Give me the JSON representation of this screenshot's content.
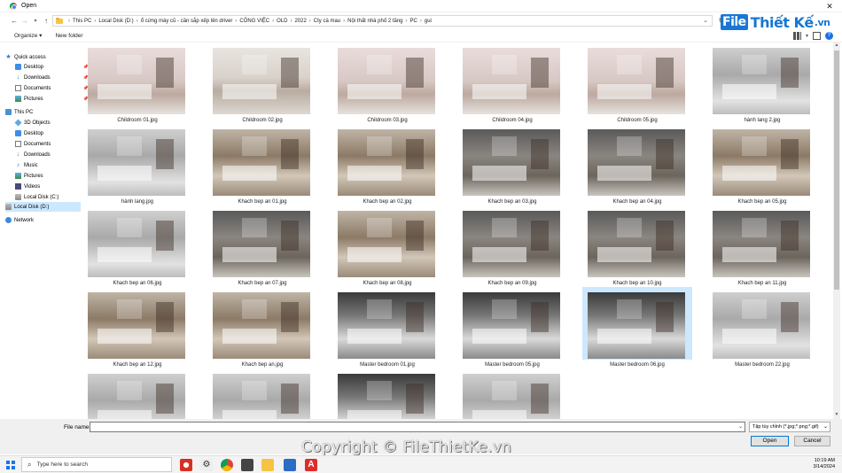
{
  "window": {
    "title": "Open"
  },
  "address": {
    "crumbs": [
      "This PC",
      "Local Disk (D:)",
      "ổ cứng máy cũ - cần sắp xếp lên driver",
      "CÔNG VIỆC",
      "OLD",
      "2022",
      "Cty cà mau",
      "Nội thất nhà phố 2 tầng",
      "PC",
      "gui"
    ]
  },
  "logo": {
    "file": "File",
    "rest": "Thiết Kế",
    "tld": ".vn"
  },
  "toolbar": {
    "organize": "Organize ▾",
    "new_folder": "New folder"
  },
  "sidebar": {
    "items": [
      {
        "label": "Quick access",
        "icon": "star-icon"
      },
      {
        "label": "Desktop",
        "icon": "desktop-icon",
        "pinned": true
      },
      {
        "label": "Downloads",
        "icon": "download-icon",
        "pinned": true
      },
      {
        "label": "Documents",
        "icon": "documents-icon",
        "pinned": true
      },
      {
        "label": "Pictures",
        "icon": "pictures-icon",
        "pinned": true
      },
      {
        "label": "This PC",
        "icon": "pc-icon"
      },
      {
        "label": "3D Objects",
        "icon": "objects-3d-icon"
      },
      {
        "label": "Desktop",
        "icon": "desktop-icon"
      },
      {
        "label": "Documents",
        "icon": "documents-icon"
      },
      {
        "label": "Downloads",
        "icon": "download-icon"
      },
      {
        "label": "Music",
        "icon": "music-icon"
      },
      {
        "label": "Pictures",
        "icon": "pictures-icon"
      },
      {
        "label": "Videos",
        "icon": "videos-icon"
      },
      {
        "label": "Local Disk (C:)",
        "icon": "disk-icon"
      },
      {
        "label": "Local Disk (D:)",
        "icon": "disk-icon",
        "selected": true
      },
      {
        "label": "Network",
        "icon": "network-icon"
      }
    ]
  },
  "files": [
    {
      "name": "Childroom 01.jpg",
      "tone": "pink"
    },
    {
      "name": "Childroom 02.jpg",
      "tone": "light"
    },
    {
      "name": "Childroom 03.jpg",
      "tone": "pink"
    },
    {
      "name": "Childroom 04.jpg",
      "tone": "pink"
    },
    {
      "name": "Childroom 05.jpg",
      "tone": "pink"
    },
    {
      "name": "hành lang 2.jpg",
      "tone": "grey"
    },
    {
      "name": "hành lang.jpg",
      "tone": "grey"
    },
    {
      "name": "Khach bep an 01.jpg",
      "tone": "warm"
    },
    {
      "name": "Khach bep an 02.jpg",
      "tone": "warm"
    },
    {
      "name": "Khach bep an 03.jpg",
      "tone": "dark"
    },
    {
      "name": "Khach bep an 04.jpg",
      "tone": "dark"
    },
    {
      "name": "Khach bep an 05.jpg",
      "tone": "warm"
    },
    {
      "name": "Khach bep an 06.jpg",
      "tone": "grey"
    },
    {
      "name": "Khach bep an 07.jpg",
      "tone": "dark"
    },
    {
      "name": "Khach bep an 08.jpg",
      "tone": "warm"
    },
    {
      "name": "Khach bep an 09.jpg",
      "tone": "dark"
    },
    {
      "name": "Khach bep an 10.jpg",
      "tone": "dark"
    },
    {
      "name": "Khach bep an 11.jpg",
      "tone": "dark"
    },
    {
      "name": "Khach bep an 12.jpg",
      "tone": "warm"
    },
    {
      "name": "Khach bep an.jpg",
      "tone": "warm"
    },
    {
      "name": "Master bedroom 01.jpg",
      "tone": "bw"
    },
    {
      "name": "Master bedroom 05.jpg",
      "tone": "bw"
    },
    {
      "name": "Master bedroom 06.jpg",
      "tone": "bw",
      "selected": true
    },
    {
      "name": "Master bedroom 22.jpg",
      "tone": "grey"
    },
    {
      "name": "",
      "tone": "grey"
    },
    {
      "name": "",
      "tone": "grey"
    },
    {
      "name": "",
      "tone": "bw"
    },
    {
      "name": "",
      "tone": "grey"
    }
  ],
  "footer": {
    "filename_label": "File name:",
    "filename_value": "",
    "filter": "Tập tùy chỉnh (*.jpg;*.png;*.gif)",
    "open": "Open",
    "cancel": "Cancel"
  },
  "watermark": "Copyright © FileThietKe.vn",
  "taskbar": {
    "search_placeholder": "Type here to search",
    "time": "10:19 AM",
    "date": "3/14/2024"
  }
}
